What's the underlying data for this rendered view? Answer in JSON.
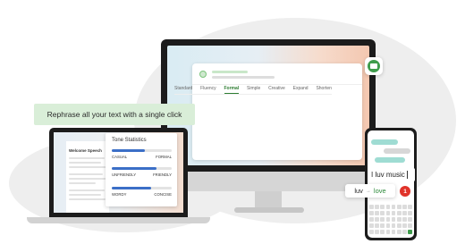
{
  "desktop_app": {
    "tabs": [
      "Standard",
      "Fluency",
      "Formal",
      "Simple",
      "Creative",
      "Expand",
      "Shorten"
    ],
    "active_tab": "Formal",
    "banner_text": "Rephrase all your text with a single click"
  },
  "laptop_app": {
    "document_title": "Welcome Speech",
    "tone_panel": {
      "title": "Tone Statistics",
      "scales": [
        {
          "left": "CASUAL",
          "right": "FORMAL",
          "level": 0.55
        },
        {
          "left": "UNFRIENDLY",
          "right": "FRIENDLY",
          "level": 0.75
        },
        {
          "left": "WORDY",
          "right": "CONCISE",
          "level": 0.65
        }
      ]
    }
  },
  "phone_app": {
    "input_text": "I luv music",
    "suggestion": {
      "original": "luv",
      "arrow": "→",
      "replacement": "love"
    },
    "badge_count": "1"
  },
  "colors": {
    "accent_green": "#3f9c4c",
    "suggestion_green": "#2e8b3b",
    "tone_bar_blue": "#3b6fc7",
    "badge_red": "#e0332a"
  },
  "icons": [
    "robot-icon"
  ]
}
